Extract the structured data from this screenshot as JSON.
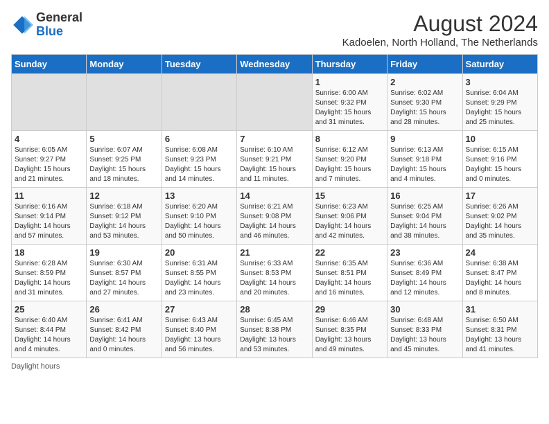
{
  "header": {
    "logo_line1": "General",
    "logo_line2": "Blue",
    "month_year": "August 2024",
    "location": "Kadoelen, North Holland, The Netherlands"
  },
  "days_of_week": [
    "Sunday",
    "Monday",
    "Tuesday",
    "Wednesday",
    "Thursday",
    "Friday",
    "Saturday"
  ],
  "weeks": [
    [
      {
        "day": "",
        "empty": true
      },
      {
        "day": "",
        "empty": true
      },
      {
        "day": "",
        "empty": true
      },
      {
        "day": "",
        "empty": true
      },
      {
        "day": "1",
        "sunrise": "6:00 AM",
        "sunset": "9:32 PM",
        "daylight": "15 hours and 31 minutes."
      },
      {
        "day": "2",
        "sunrise": "6:02 AM",
        "sunset": "9:30 PM",
        "daylight": "15 hours and 28 minutes."
      },
      {
        "day": "3",
        "sunrise": "6:04 AM",
        "sunset": "9:29 PM",
        "daylight": "15 hours and 25 minutes."
      }
    ],
    [
      {
        "day": "4",
        "sunrise": "6:05 AM",
        "sunset": "9:27 PM",
        "daylight": "15 hours and 21 minutes."
      },
      {
        "day": "5",
        "sunrise": "6:07 AM",
        "sunset": "9:25 PM",
        "daylight": "15 hours and 18 minutes."
      },
      {
        "day": "6",
        "sunrise": "6:08 AM",
        "sunset": "9:23 PM",
        "daylight": "15 hours and 14 minutes."
      },
      {
        "day": "7",
        "sunrise": "6:10 AM",
        "sunset": "9:21 PM",
        "daylight": "15 hours and 11 minutes."
      },
      {
        "day": "8",
        "sunrise": "6:12 AM",
        "sunset": "9:20 PM",
        "daylight": "15 hours and 7 minutes."
      },
      {
        "day": "9",
        "sunrise": "6:13 AM",
        "sunset": "9:18 PM",
        "daylight": "15 hours and 4 minutes."
      },
      {
        "day": "10",
        "sunrise": "6:15 AM",
        "sunset": "9:16 PM",
        "daylight": "15 hours and 0 minutes."
      }
    ],
    [
      {
        "day": "11",
        "sunrise": "6:16 AM",
        "sunset": "9:14 PM",
        "daylight": "14 hours and 57 minutes."
      },
      {
        "day": "12",
        "sunrise": "6:18 AM",
        "sunset": "9:12 PM",
        "daylight": "14 hours and 53 minutes."
      },
      {
        "day": "13",
        "sunrise": "6:20 AM",
        "sunset": "9:10 PM",
        "daylight": "14 hours and 50 minutes."
      },
      {
        "day": "14",
        "sunrise": "6:21 AM",
        "sunset": "9:08 PM",
        "daylight": "14 hours and 46 minutes."
      },
      {
        "day": "15",
        "sunrise": "6:23 AM",
        "sunset": "9:06 PM",
        "daylight": "14 hours and 42 minutes."
      },
      {
        "day": "16",
        "sunrise": "6:25 AM",
        "sunset": "9:04 PM",
        "daylight": "14 hours and 38 minutes."
      },
      {
        "day": "17",
        "sunrise": "6:26 AM",
        "sunset": "9:02 PM",
        "daylight": "14 hours and 35 minutes."
      }
    ],
    [
      {
        "day": "18",
        "sunrise": "6:28 AM",
        "sunset": "8:59 PM",
        "daylight": "14 hours and 31 minutes."
      },
      {
        "day": "19",
        "sunrise": "6:30 AM",
        "sunset": "8:57 PM",
        "daylight": "14 hours and 27 minutes."
      },
      {
        "day": "20",
        "sunrise": "6:31 AM",
        "sunset": "8:55 PM",
        "daylight": "14 hours and 23 minutes."
      },
      {
        "day": "21",
        "sunrise": "6:33 AM",
        "sunset": "8:53 PM",
        "daylight": "14 hours and 20 minutes."
      },
      {
        "day": "22",
        "sunrise": "6:35 AM",
        "sunset": "8:51 PM",
        "daylight": "14 hours and 16 minutes."
      },
      {
        "day": "23",
        "sunrise": "6:36 AM",
        "sunset": "8:49 PM",
        "daylight": "14 hours and 12 minutes."
      },
      {
        "day": "24",
        "sunrise": "6:38 AM",
        "sunset": "8:47 PM",
        "daylight": "14 hours and 8 minutes."
      }
    ],
    [
      {
        "day": "25",
        "sunrise": "6:40 AM",
        "sunset": "8:44 PM",
        "daylight": "14 hours and 4 minutes."
      },
      {
        "day": "26",
        "sunrise": "6:41 AM",
        "sunset": "8:42 PM",
        "daylight": "14 hours and 0 minutes."
      },
      {
        "day": "27",
        "sunrise": "6:43 AM",
        "sunset": "8:40 PM",
        "daylight": "13 hours and 56 minutes."
      },
      {
        "day": "28",
        "sunrise": "6:45 AM",
        "sunset": "8:38 PM",
        "daylight": "13 hours and 53 minutes."
      },
      {
        "day": "29",
        "sunrise": "6:46 AM",
        "sunset": "8:35 PM",
        "daylight": "13 hours and 49 minutes."
      },
      {
        "day": "30",
        "sunrise": "6:48 AM",
        "sunset": "8:33 PM",
        "daylight": "13 hours and 45 minutes."
      },
      {
        "day": "31",
        "sunrise": "6:50 AM",
        "sunset": "8:31 PM",
        "daylight": "13 hours and 41 minutes."
      }
    ]
  ],
  "footer": {
    "note": "Daylight hours"
  }
}
